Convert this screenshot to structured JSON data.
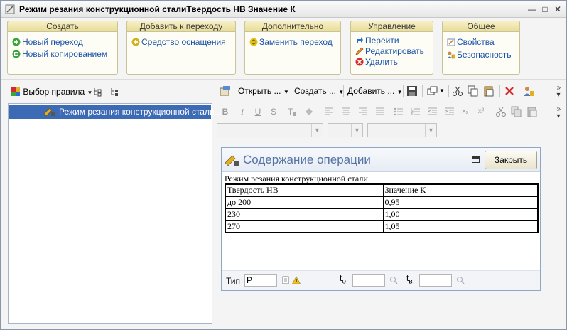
{
  "window": {
    "title": "Режим резания конструкционной сталиТвердость НВ Значение К",
    "minimize_glyph": "—",
    "maximize_glyph": "□",
    "close_glyph": "✕"
  },
  "ribbon": {
    "groups": [
      {
        "header": "Создать",
        "items": [
          {
            "label": "Новый переход",
            "icon": "add-circle-icon"
          },
          {
            "label": "Новый копированием",
            "icon": "copy-add-icon"
          }
        ]
      },
      {
        "header": "Добавить к переходу",
        "items": [
          {
            "label": "Средство оснащения",
            "icon": "add-circle-icon"
          }
        ]
      },
      {
        "header": "Дополнительно",
        "items": [
          {
            "label": "Заменить переход",
            "icon": "replace-icon"
          }
        ]
      },
      {
        "header": "Управление",
        "items": [
          {
            "label": "Перейти",
            "icon": "goto-icon"
          },
          {
            "label": "Редактировать",
            "icon": "edit-icon"
          },
          {
            "label": "Удалить",
            "icon": "delete-icon"
          }
        ]
      },
      {
        "header": "Общее",
        "items": [
          {
            "label": "Свойства",
            "icon": "properties-icon"
          },
          {
            "label": "Безопасность",
            "icon": "security-icon"
          }
        ]
      }
    ]
  },
  "left_toolbar": {
    "rule_select_label": "Выбор правила"
  },
  "tree": {
    "selected_item": "Режим резания конструкционной стали..."
  },
  "right_toolbar": {
    "open_label": "Открыть ...",
    "create_label": "Создать ...",
    "add_label": "Добавить ..."
  },
  "format_bar": {
    "bold": "B",
    "italic": "I",
    "underline": "U",
    "strike": "S",
    "subscript": "x₂",
    "superscript": "x²"
  },
  "panel": {
    "title": "Содержание операции",
    "close_label": "Закрыть",
    "content_title": "Режим резания конструкционной стали",
    "table": {
      "headers": [
        "Твердость НВ",
        "Значение К"
      ],
      "rows": [
        [
          "до 200",
          "0,95"
        ],
        [
          "230",
          "1,00"
        ],
        [
          "270",
          "1,05"
        ]
      ]
    },
    "footer": {
      "type_label": "Тип",
      "type_value": "Р",
      "to_label_main": "t",
      "to_label_sub": "о",
      "tv_label_main": "t",
      "tv_label_sub": "в",
      "to_value": "",
      "tv_value": ""
    }
  },
  "colors": {
    "selection": "#3d6ab5",
    "link": "#1a52a8",
    "panel_title": "#5874a4"
  }
}
